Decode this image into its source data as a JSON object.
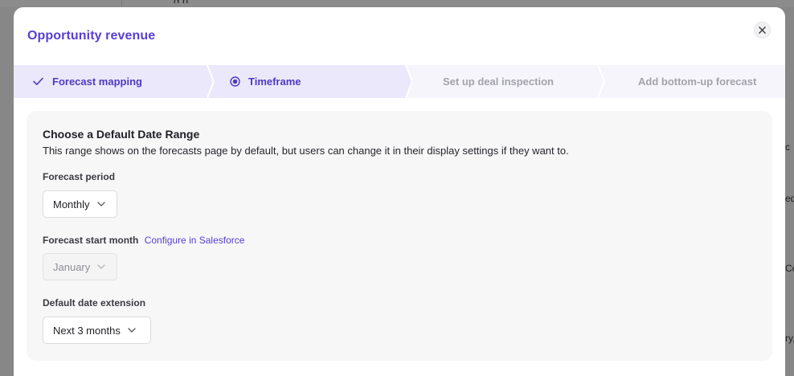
{
  "background": {
    "top_text": "g      p",
    "right_fragments": [
      "c",
      "ed",
      "Co",
      "ry,"
    ]
  },
  "modal": {
    "title": "Opportunity revenue",
    "close_icon": "close-icon"
  },
  "stepper": {
    "steps": [
      {
        "label": "Forecast mapping",
        "state": "completed",
        "icon": "check-icon"
      },
      {
        "label": "Timeframe",
        "state": "active",
        "icon": "radio-dot-icon"
      },
      {
        "label": "Set up deal inspection",
        "state": "upcoming"
      },
      {
        "label": "Add bottom-up forecast",
        "state": "upcoming"
      }
    ]
  },
  "form": {
    "title": "Choose a Default Date Range",
    "description": "This range shows on the forecasts page by default, but users can change it in their display settings if they want to.",
    "forecast_period": {
      "label": "Forecast period",
      "value": "Monthly"
    },
    "forecast_start_month": {
      "label": "Forecast start month",
      "link": "Configure in Salesforce",
      "value": "January",
      "disabled": true
    },
    "default_date_extension": {
      "label": "Default date extension",
      "value": "Next 3 months"
    }
  },
  "colors": {
    "accent": "#5a3fcf",
    "step_active_bg": "#ebe8fb",
    "card_bg": "#f7f7f8"
  }
}
